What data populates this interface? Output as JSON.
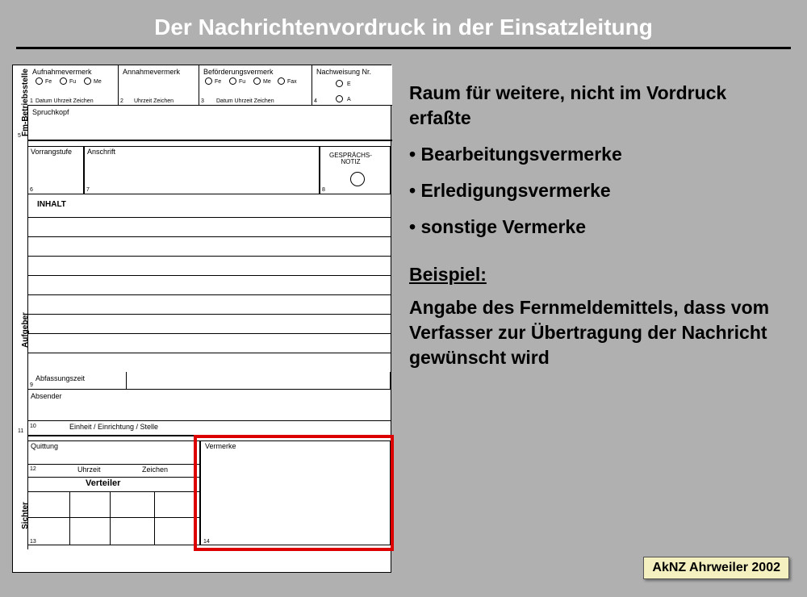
{
  "title": "Der Nachrichtenvordruck in der Einsatzleitung",
  "description": {
    "intro": "Raum für weitere, nicht im Vordruck erfaßte",
    "bullets": [
      "Bearbeitungsvermerke",
      "Erledigungsvermerke",
      "sonstige Vermerke"
    ],
    "example_label": "Beispiel:",
    "example_text": "Angabe des Fernmeldemittels, dass vom Verfasser zur Übertragung der Nachricht gewünscht wird"
  },
  "footer": "AkNZ Ahrweiler 2002",
  "form": {
    "side_labels": {
      "fm": "Fm-Betriebsstelle",
      "aufgeber": "Aufgeber",
      "sichter": "Sichter"
    },
    "header": {
      "aufnahmevermerk": "Aufnahmevermerk",
      "annahmevermerk": "Annahmevermerk",
      "befoerderungsvermerk": "Beförderungsvermerk",
      "nachweisung": "Nachweisung Nr.",
      "radios1": [
        "Fe",
        "Fu",
        "Me"
      ],
      "radios3": [
        "Fe",
        "Fu",
        "Me",
        "Fax"
      ],
      "nachw_radios": [
        "E",
        "A"
      ],
      "sub1": "Datum  Uhrzeit  Zeichen",
      "sub2": "Uhrzeit      Zeichen",
      "sub3": "Datum  Uhrzeit  Zeichen",
      "n1": "1",
      "n2": "2",
      "n3": "3",
      "n4": "4"
    },
    "spruchkopf": "Spruchkopf",
    "n5": "5",
    "vorrangstufe": "Vorrangstufe",
    "anschrift": "Anschrift",
    "gespraech": "GESPRÄCHS-\nNOTIZ",
    "n6": "6",
    "n7": "7",
    "n8": "8",
    "inhalt": "INHALT",
    "abfassungszeit": "Abfassungszeit",
    "n9": "9",
    "absender": "Absender",
    "einheit": "Einheit / Einrichtung / Stelle",
    "n10": "10",
    "n11": "11",
    "quittung": "Quittung",
    "uhrzeit": "Uhrzeit",
    "zeichen": "Zeichen",
    "n12": "12",
    "verteiler": "Verteiler",
    "n13": "13",
    "vermerke": "Vermerke",
    "n14": "14"
  }
}
